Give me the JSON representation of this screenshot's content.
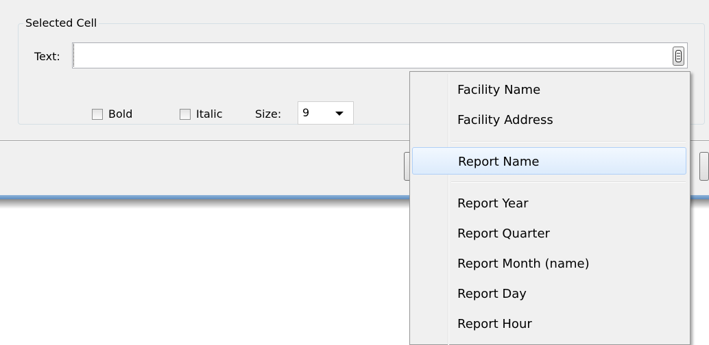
{
  "group": {
    "title": "Selected Cell"
  },
  "text_field": {
    "label": "Text:",
    "value": ""
  },
  "format": {
    "bold_label": "Bold",
    "bold_checked": false,
    "italic_label": "Italic",
    "italic_checked": false,
    "size_label": "Size:",
    "size_value": "9"
  },
  "menu": {
    "highlighted": "Report Name",
    "group1": [
      "Facility Name",
      "Facility Address"
    ],
    "group2": [
      "Report Name"
    ],
    "group3": [
      "Report Year",
      "Report Quarter",
      "Report Month (name)",
      "Report Day",
      "Report Hour"
    ]
  },
  "colors": {
    "dialog_bg": "#f0f0f0",
    "window_border": "#5d8cbf",
    "menu_highlight": "#dcebfc"
  },
  "icons": {
    "insert_field_button": "insert-field-icon",
    "size_dropdown": "chevron-down-icon"
  }
}
